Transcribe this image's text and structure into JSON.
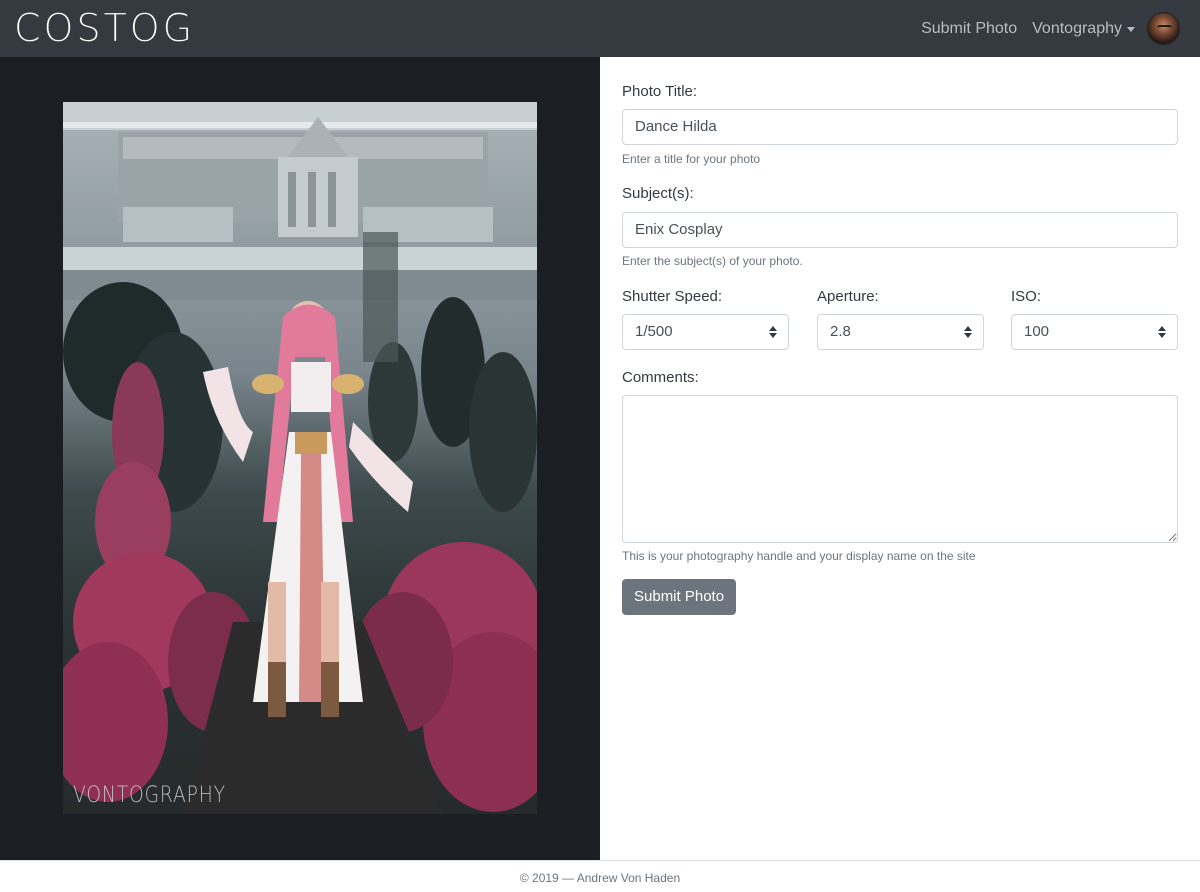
{
  "navbar": {
    "brand": "COSTOG",
    "submit_link": "Submit Photo",
    "user_menu": "Vontography",
    "avatar_icon": "user-avatar"
  },
  "photo": {
    "watermark": "VONTOGRAPHY"
  },
  "form": {
    "title_label": "Photo Title:",
    "title_value": "Dance Hilda",
    "title_help": "Enter a title for your photo",
    "subject_label": "Subject(s):",
    "subject_value": "Enix Cosplay",
    "subject_help": "Enter the subject(s) of your photo.",
    "shutter_label": "Shutter Speed:",
    "shutter_value": "1/500",
    "aperture_label": "Aperture:",
    "aperture_value": "2.8",
    "iso_label": "ISO:",
    "iso_value": "100",
    "comments_label": "Comments:",
    "comments_value": "",
    "comments_help": "This is your photography handle and your display name on the site",
    "submit_label": "Submit Photo"
  },
  "footer": {
    "text": "© 2019 — Andrew Von Haden"
  },
  "colors": {
    "navbar_bg": "#343a40",
    "photo_panel_bg": "#1b1f24",
    "button_bg": "#6c757d"
  }
}
